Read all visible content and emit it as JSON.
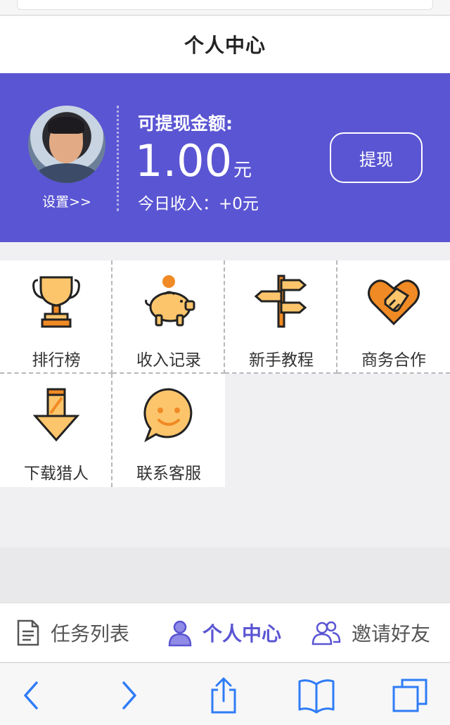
{
  "header": {
    "title": "个人中心"
  },
  "account": {
    "settings_link": "设置>>",
    "withdrawable_label": "可提现金额:",
    "amount": "1.00",
    "amount_unit": "元",
    "today_income": "今日收入：+0元",
    "withdraw_button": "提现"
  },
  "menu": {
    "items": [
      {
        "label": "排行榜",
        "icon": "trophy-icon"
      },
      {
        "label": "收入记录",
        "icon": "piggy-bank-icon"
      },
      {
        "label": "新手教程",
        "icon": "signpost-icon"
      },
      {
        "label": "商务合作",
        "icon": "handshake-icon"
      },
      {
        "label": "下载猎人",
        "icon": "download-arrow-icon"
      },
      {
        "label": "联系客服",
        "icon": "chat-smile-icon"
      }
    ]
  },
  "tabbar": {
    "tabs": [
      {
        "label": "任务列表",
        "icon": "document-icon",
        "active": false
      },
      {
        "label": "个人中心",
        "icon": "user-icon",
        "active": true
      },
      {
        "label": "邀请好友",
        "icon": "users-icon",
        "active": false
      }
    ]
  },
  "browser_toolbar": {
    "icons": [
      "back-icon",
      "forward-icon",
      "share-icon",
      "bookmarks-icon",
      "tabs-icon"
    ]
  },
  "colors": {
    "accent": "#5a55d3",
    "icon_orange": "#f08a24",
    "icon_yellow": "#fcc56b",
    "browser_blue": "#2f7cf6"
  }
}
